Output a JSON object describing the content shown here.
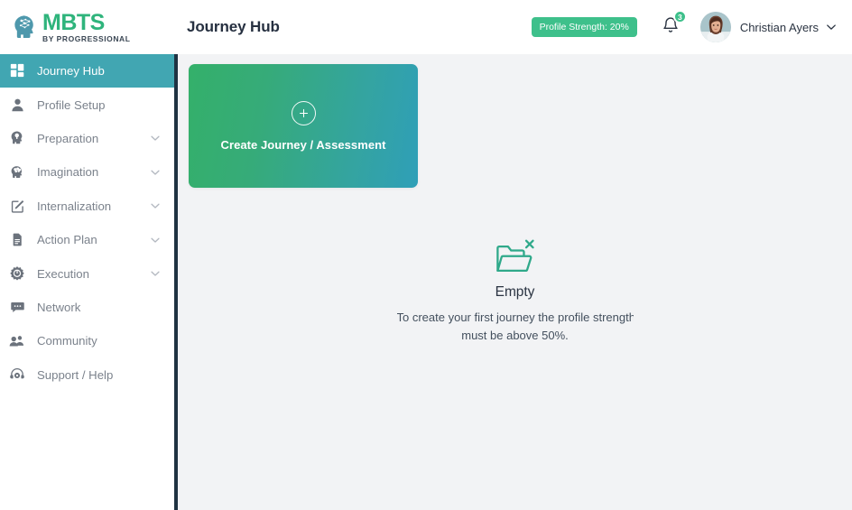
{
  "brand": {
    "name": "MBTS",
    "tagline": "BY PROGRESSIONAL",
    "logo_icon": "head-network-icon",
    "brand_color": "#2fb47c",
    "accent_color": "#41a6b2"
  },
  "sidebar": {
    "items": [
      {
        "label": "Journey Hub",
        "icon": "dashboard-grid-icon",
        "active": true,
        "expandable": false
      },
      {
        "label": "Profile Setup",
        "icon": "user-icon",
        "active": false,
        "expandable": false
      },
      {
        "label": "Preparation",
        "icon": "head-bulb-icon",
        "active": false,
        "expandable": true
      },
      {
        "label": "Imagination",
        "icon": "head-brain-icon",
        "active": false,
        "expandable": true
      },
      {
        "label": "Internalization",
        "icon": "edit-square-icon",
        "active": false,
        "expandable": true
      },
      {
        "label": "Action Plan",
        "icon": "document-icon",
        "active": false,
        "expandable": true
      },
      {
        "label": "Execution",
        "icon": "power-gear-icon",
        "active": false,
        "expandable": true
      },
      {
        "label": "Network",
        "icon": "chat-bubble-icon",
        "active": false,
        "expandable": false
      },
      {
        "label": "Community",
        "icon": "people-group-icon",
        "active": false,
        "expandable": false
      },
      {
        "label": "Support / Help",
        "icon": "headset-gear-icon",
        "active": false,
        "expandable": false
      }
    ]
  },
  "header": {
    "title": "Journey Hub",
    "profile_strength_label": "Profile Strength: 20%",
    "profile_strength_color": "#3ec08b",
    "notification_icon": "bell-icon",
    "notification_count": "3",
    "avatar_icon": "user-avatar-photo",
    "user_name": "Christian Ayers",
    "user_menu_icon": "chevron-down-icon"
  },
  "main": {
    "create_card": {
      "label": "Create Journey / Assessment",
      "icon": "plus-circle-icon",
      "gradient_from": "#34b06a",
      "gradient_to": "#2f9fb8"
    },
    "empty_state": {
      "icon": "empty-folder-icon",
      "icon_color": "#2fa98a",
      "title": "Empty",
      "description_line1": "To create your first journey the profile strength",
      "description_line2": "must be above 50%."
    }
  }
}
